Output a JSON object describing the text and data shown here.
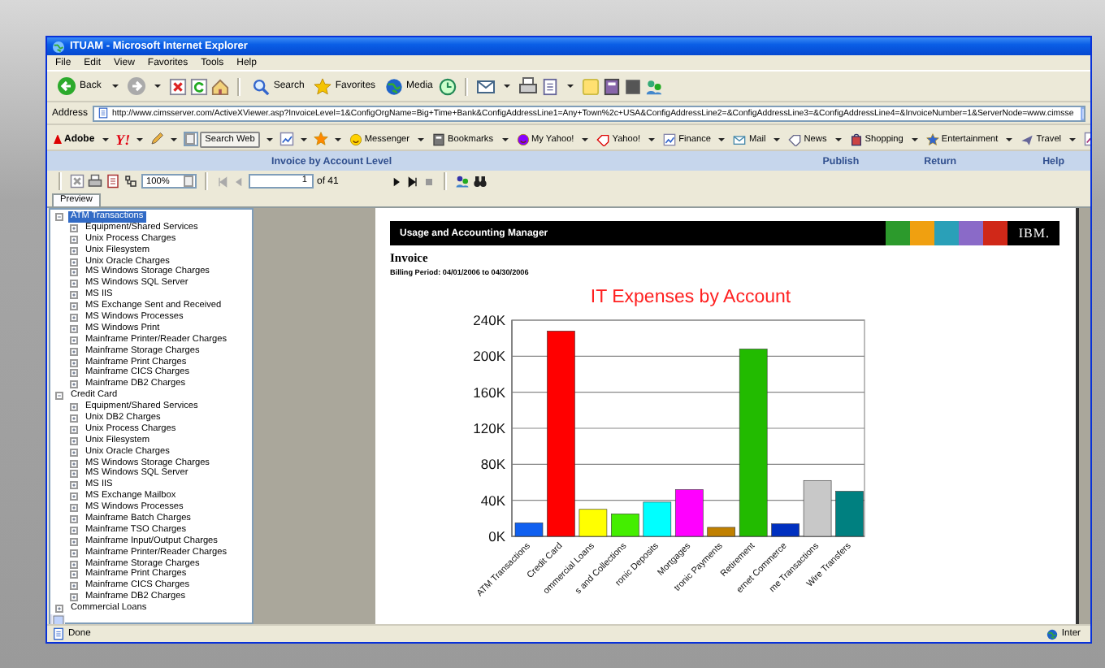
{
  "window": {
    "title": "ITUAM - Microsoft Internet Explorer"
  },
  "menu": [
    "File",
    "Edit",
    "View",
    "Favorites",
    "Tools",
    "Help"
  ],
  "toolbar": {
    "back": "Back",
    "buttons": [
      "Search",
      "Favorites",
      "Media"
    ]
  },
  "address": {
    "label": "Address",
    "value": "http://www.cimsserver.com/ActiveXViewer.asp?InvoiceLevel=1&ConfigOrgName=Big+Time+Bank&ConfigAddressLine1=Any+Town%2c+USA&ConfigAddressLine2=&ConfigAddressLine3=&ConfigAddressLine4=&InvoiceNumber=1&ServerNode=www.cimsse"
  },
  "links_toolbar": {
    "adobe": "Adobe",
    "yahoo": "Y!",
    "search_button": "Search Web",
    "items": [
      "Messenger",
      "Bookmarks",
      "My Yahoo!",
      "Yahoo!",
      "Finance",
      "Mail",
      "News",
      "Shopping",
      "Entertainment",
      "Travel"
    ]
  },
  "report_bar": {
    "title": "Invoice by Account Level",
    "links": [
      "Publish",
      "Return",
      "Help"
    ]
  },
  "viewer_toolbar": {
    "zoom": "100%",
    "page": "1",
    "page_count": "of 41"
  },
  "tabs": [
    {
      "label": "Preview",
      "selected": true
    }
  ],
  "tree": [
    {
      "label": "ATM Transactions",
      "selected": true,
      "expanded": true,
      "children": [
        {
          "label": "Equipment/Shared Services",
          "selected": false,
          "expanded": false
        },
        {
          "label": "Unix Process Charges",
          "selected": false,
          "expanded": false
        },
        {
          "label": "Unix Filesystem",
          "selected": false,
          "expanded": false
        },
        {
          "label": "Unix Oracle Charges",
          "selected": false,
          "expanded": false
        },
        {
          "label": "MS Windows Storage Charges",
          "selected": false,
          "expanded": false
        },
        {
          "label": "MS Windows SQL Server",
          "selected": false,
          "expanded": false
        },
        {
          "label": "MS IIS",
          "selected": false,
          "expanded": false
        },
        {
          "label": "MS Exchange Sent and Received",
          "selected": false,
          "expanded": false
        },
        {
          "label": "MS Windows Processes",
          "selected": false,
          "expanded": false
        },
        {
          "label": "MS Windows Print",
          "selected": false,
          "expanded": false
        },
        {
          "label": "Mainframe Printer/Reader Charges",
          "selected": false,
          "expanded": false
        },
        {
          "label": "Mainframe Storage Charges",
          "selected": false,
          "expanded": false
        },
        {
          "label": "Mainframe Print Charges",
          "selected": false,
          "expanded": false
        },
        {
          "label": "Mainframe CICS Charges",
          "selected": false,
          "expanded": false
        },
        {
          "label": "Mainframe DB2 Charges",
          "selected": false,
          "expanded": false
        }
      ]
    },
    {
      "label": "Credit Card",
      "selected": false,
      "expanded": true,
      "children": [
        {
          "label": "Equipment/Shared Services",
          "selected": false,
          "expanded": false
        },
        {
          "label": "Unix DB2 Charges",
          "selected": false,
          "expanded": false
        },
        {
          "label": "Unix Process Charges",
          "selected": false,
          "expanded": false
        },
        {
          "label": "Unix Filesystem",
          "selected": false,
          "expanded": false
        },
        {
          "label": "Unix Oracle Charges",
          "selected": false,
          "expanded": false
        },
        {
          "label": "MS Windows Storage Charges",
          "selected": false,
          "expanded": false
        },
        {
          "label": "MS Windows SQL Server",
          "selected": false,
          "expanded": false
        },
        {
          "label": "MS IIS",
          "selected": false,
          "expanded": false
        },
        {
          "label": "MS Exchange Mailbox",
          "selected": false,
          "expanded": false
        },
        {
          "label": "MS Windows Processes",
          "selected": false,
          "expanded": false
        },
        {
          "label": "Mainframe Batch Charges",
          "selected": false,
          "expanded": false
        },
        {
          "label": "Mainframe TSO Charges",
          "selected": false,
          "expanded": false
        },
        {
          "label": "Mainframe Input/Output Charges",
          "selected": false,
          "expanded": false
        },
        {
          "label": "Mainframe Printer/Reader Charges",
          "selected": false,
          "expanded": false
        },
        {
          "label": "Mainframe Storage Charges",
          "selected": false,
          "expanded": false
        },
        {
          "label": "Mainframe Print Charges",
          "selected": false,
          "expanded": false
        },
        {
          "label": "Mainframe CICS Charges",
          "selected": false,
          "expanded": false
        },
        {
          "label": "Mainframe DB2 Charges",
          "selected": false,
          "expanded": false
        }
      ]
    },
    {
      "label": "Commercial Loans",
      "selected": false,
      "expanded": false
    }
  ],
  "report": {
    "banner": "Usage and Accounting Manager",
    "logo": "IBM.",
    "heading": "Invoice",
    "billing_period": "Billing Period: 04/01/2006 to 04/30/2006",
    "chart_data": {
      "type": "bar",
      "title": "IT Expenses by Account",
      "categories": [
        "ATM Transactions",
        "Credit Card",
        "ommercial Loans",
        "s and Collections",
        "ronic Deposits",
        "Mortgages",
        "tronic Payments",
        "Retirement",
        "ernet Commerce",
        "me Transactions",
        "Wire Transfers"
      ],
      "values": [
        15000,
        228000,
        30000,
        25000,
        38000,
        52000,
        10000,
        208000,
        14000,
        62000,
        50000
      ],
      "colors": [
        "#1060f0",
        "#ff0000",
        "#ffff00",
        "#44ee00",
        "#00ffff",
        "#ff00ff",
        "#c08000",
        "#22bb00",
        "#0030c0",
        "#c8c8c8",
        "#008080"
      ],
      "ylim": [
        0,
        240000
      ],
      "grid": true,
      "yticks": [
        {
          "value": 0,
          "label": "0K"
        },
        {
          "value": 40000,
          "label": "40K"
        },
        {
          "value": 80000,
          "label": "80K"
        },
        {
          "value": 120000,
          "label": "120K"
        },
        {
          "value": 160000,
          "label": "160K"
        },
        {
          "value": 200000,
          "label": "200K"
        },
        {
          "value": 240000,
          "label": "240K"
        }
      ]
    }
  },
  "status_bar": {
    "text": "Done",
    "zone": "Inter"
  }
}
